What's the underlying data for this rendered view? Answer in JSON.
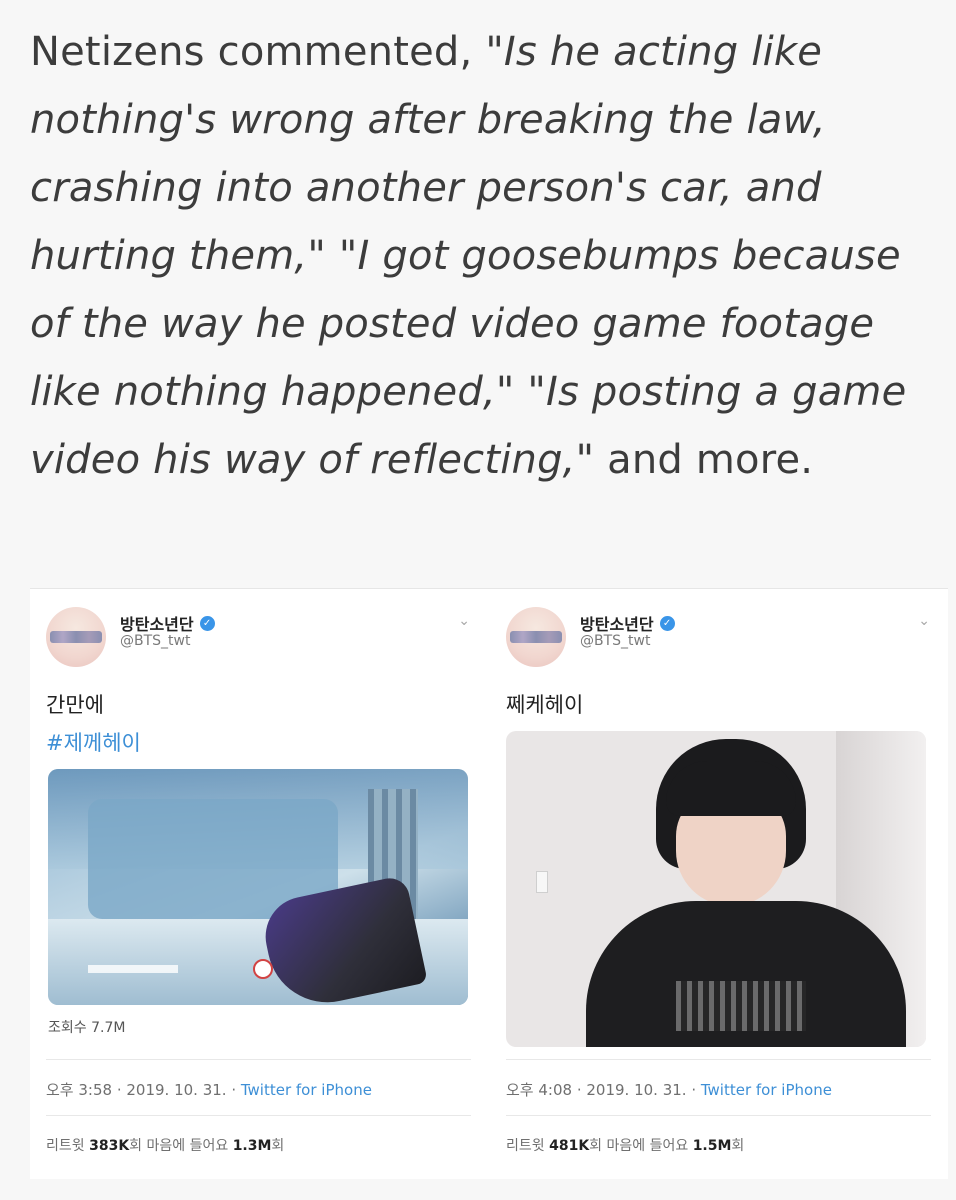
{
  "article": {
    "intro": "Netizens commented, ",
    "quote_part": "\"Is he acting like nothing's wrong after breaking the law, crashing into another person's car, and hurting them,\" \"I got goosebumps because of the way he posted video game footage like nothing happened,\" \"Is posting a game video his way of reflecting,\"",
    "outro": " and more."
  },
  "tweets": [
    {
      "display_name": "방탄소년단",
      "handle": "@BTS_twt",
      "text": "간만에",
      "hashtag": "#제께헤이",
      "views": "조회수 7.7M",
      "time": "오후 3:58 · 2019. 10. 31. · ",
      "source": "Twitter for iPhone",
      "retweet_label": "리트윗 ",
      "retweets": "383K",
      "retweet_unit": "회  마음에 들어요 ",
      "likes": "1.3M",
      "likes_unit": "회"
    },
    {
      "display_name": "방탄소년단",
      "handle": "@BTS_twt",
      "text": "쩨케헤이",
      "time": "오후 4:08 · 2019. 10. 31. · ",
      "source": "Twitter for iPhone",
      "retweet_label": "리트윗 ",
      "retweets": "481K",
      "retweet_unit": "회  마음에 들어요 ",
      "likes": "1.5M",
      "likes_unit": "회"
    }
  ],
  "icons": {
    "verified": "verified-badge-icon",
    "chevron": "chevron-down-icon"
  },
  "colors": {
    "link": "#3d8fd6",
    "verified": "#3a95e8",
    "text": "#3c3c3c"
  }
}
